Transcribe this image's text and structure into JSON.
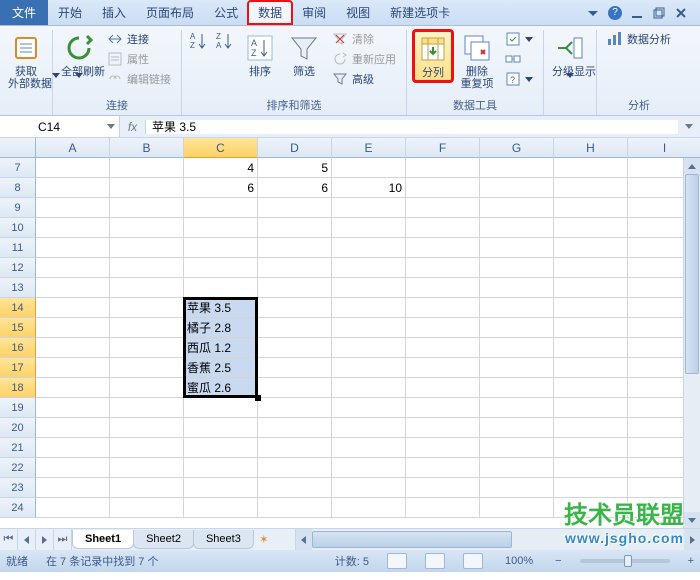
{
  "menu": {
    "file": "文件",
    "items": [
      "开始",
      "插入",
      "页面布局",
      "公式",
      "数据",
      "审阅",
      "视图",
      "新建选项卡"
    ],
    "active_index": 4
  },
  "ribbon": {
    "groups": {
      "external": {
        "label": "",
        "get_external": "获取",
        "external_data": "外部数据"
      },
      "connections": {
        "label": "连接",
        "refresh_all": "全部刷新",
        "connections_btn": "连接",
        "properties": "属性",
        "edit_links": "编辑链接"
      },
      "sort_filter": {
        "label": "排序和筛选",
        "sort": "排序",
        "filter": "筛选",
        "clear": "清除",
        "reapply": "重新应用",
        "advanced": "高级"
      },
      "data_tools": {
        "label": "数据工具",
        "text_to_columns": "分列",
        "remove_duplicates": "删除",
        "dup2": "重复项"
      },
      "outline": {
        "label": "",
        "subtotal": "分级显示"
      },
      "analysis": {
        "label": "分析",
        "data_analysis": "数据分析"
      }
    }
  },
  "name_box": "C14",
  "formula_bar": "苹果 3.5",
  "grid": {
    "columns": [
      "A",
      "B",
      "C",
      "D",
      "E",
      "F",
      "G",
      "H",
      "I"
    ],
    "row_start": 7,
    "row_end": 24,
    "active_col": "C",
    "selection": {
      "col": "C",
      "rows": [
        14,
        15,
        16,
        17,
        18
      ]
    },
    "cells_num": {
      "7": {
        "C": "4",
        "D": "5"
      },
      "8": {
        "C": "6",
        "D": "6",
        "E": "10"
      }
    },
    "cells_text": {
      "14": {
        "C": "苹果 3.5"
      },
      "15": {
        "C": "橘子 2.8"
      },
      "16": {
        "C": "西瓜 1.2"
      },
      "17": {
        "C": "香蕉 2.5"
      },
      "18": {
        "C": "蜜瓜 2.6"
      }
    }
  },
  "sheets": {
    "tabs": [
      "Sheet1",
      "Sheet2",
      "Sheet3"
    ],
    "active_index": 0
  },
  "status": {
    "mode": "就绪",
    "find_result": "在 7 条记录中找到 7 个",
    "count_label": "计数:",
    "count_value": "5",
    "zoom": "100%"
  },
  "watermark": {
    "line1": "技术员联盟",
    "line2": "www.jsgho.com"
  }
}
